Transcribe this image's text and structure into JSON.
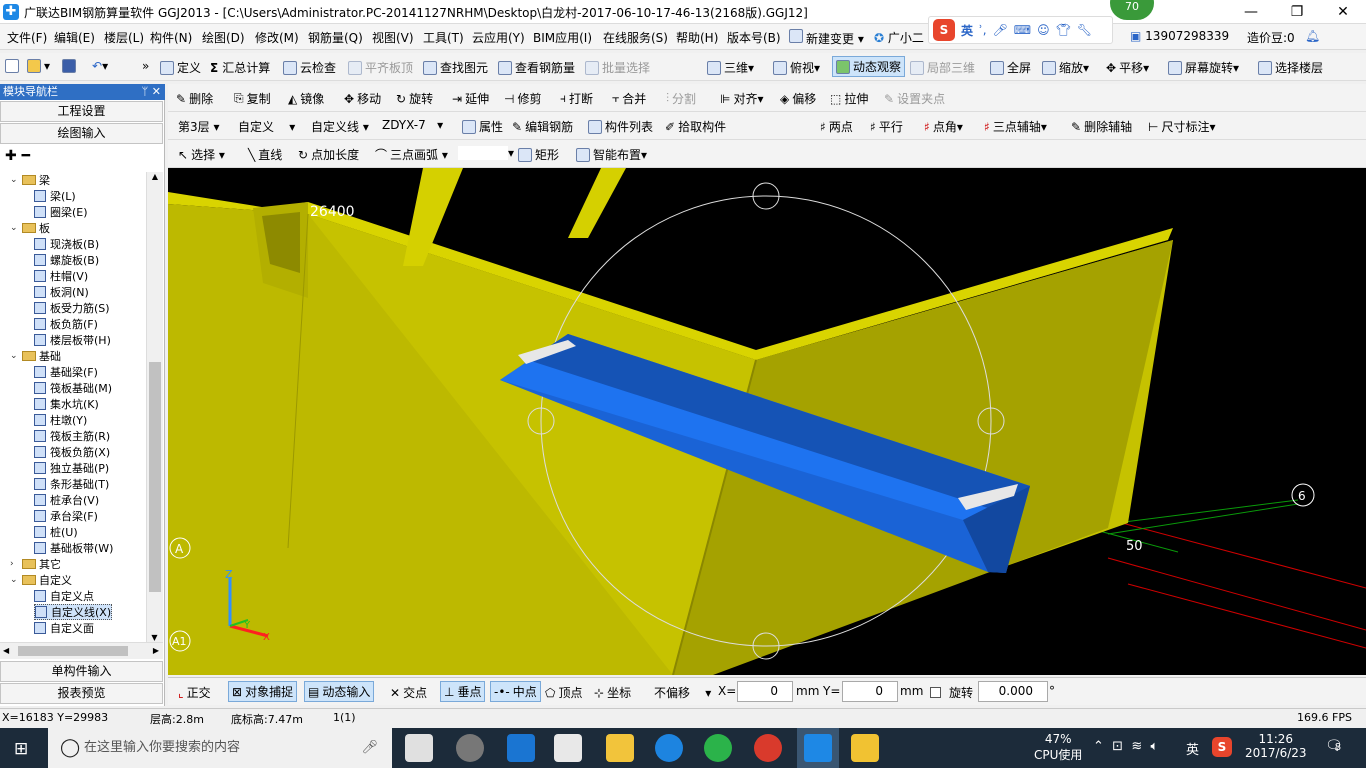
{
  "window": {
    "title": "广联达BIM钢筋算量软件 GGJ2013 - [C:\\Users\\Administrator.PC-20141127NRHM\\Desktop\\白龙村-2017-06-10-17-46-13(2168版).GGJ12]",
    "badge": "70",
    "controls": [
      "—",
      "❐",
      "✕"
    ]
  },
  "menu": [
    "文件(F)",
    "编辑(E)",
    "楼层(L)",
    "构件(N)",
    "绘图(D)",
    "修改(M)",
    "钢筋量(Q)",
    "视图(V)",
    "工具(T)",
    "云应用(Y)",
    "BIM应用(I)",
    "在线服务(S)",
    "帮助(H)",
    "版本号(B)",
    "新建变更",
    "广小二"
  ],
  "ime": {
    "mode": "英"
  },
  "account": {
    "user": "13907298339",
    "points_label": "造价豆:0"
  },
  "toolbar1": [
    "定义",
    "汇总计算",
    "云检查",
    "平齐板顶",
    "查找图元",
    "查看钢筋量",
    "批量选择",
    "三维",
    "俯视",
    "动态观察",
    "局部三维",
    "全屏",
    "缩放",
    "平移",
    "屏幕旋转",
    "选择楼层"
  ],
  "toolbar2": [
    "删除",
    "复制",
    "镜像",
    "移动",
    "旋转",
    "延伸",
    "修剪",
    "打断",
    "合并",
    "分割",
    "对齐",
    "偏移",
    "拉伸",
    "设置夹点"
  ],
  "toolbar3": {
    "floor": "第3层",
    "category": "自定义",
    "type": "自定义线",
    "element": "ZDYX-7",
    "actions": [
      "属性",
      "编辑钢筋",
      "构件列表",
      "拾取构件"
    ],
    "right": [
      "两点",
      "平行",
      "点角",
      "三点辅轴",
      "删除辅轴",
      "尺寸标注"
    ]
  },
  "toolbar4": [
    "选择",
    "直线",
    "点加长度",
    "三点画弧",
    "矩形",
    "智能布置"
  ],
  "nav": {
    "title": "模块导航栏",
    "pin": "ᛘ ✕",
    "top_buttons": [
      "工程设置",
      "绘图输入"
    ],
    "bottom_buttons": [
      "单构件输入",
      "报表预览"
    ],
    "tree": [
      {
        "label": "梁",
        "level": 0,
        "type": "folder",
        "open": true
      },
      {
        "label": "梁(L)",
        "level": 1,
        "type": "leaf"
      },
      {
        "label": "圈梁(E)",
        "level": 1,
        "type": "leaf"
      },
      {
        "label": "板",
        "level": 0,
        "type": "folder",
        "open": true
      },
      {
        "label": "现浇板(B)",
        "level": 1,
        "type": "leaf"
      },
      {
        "label": "螺旋板(B)",
        "level": 1,
        "type": "leaf"
      },
      {
        "label": "柱帽(V)",
        "level": 1,
        "type": "leaf"
      },
      {
        "label": "板洞(N)",
        "level": 1,
        "type": "leaf"
      },
      {
        "label": "板受力筋(S)",
        "level": 1,
        "type": "leaf"
      },
      {
        "label": "板负筋(F)",
        "level": 1,
        "type": "leaf"
      },
      {
        "label": "楼层板带(H)",
        "level": 1,
        "type": "leaf"
      },
      {
        "label": "基础",
        "level": 0,
        "type": "folder",
        "open": true
      },
      {
        "label": "基础梁(F)",
        "level": 1,
        "type": "leaf"
      },
      {
        "label": "筏板基础(M)",
        "level": 1,
        "type": "leaf"
      },
      {
        "label": "集水坑(K)",
        "level": 1,
        "type": "leaf"
      },
      {
        "label": "柱墩(Y)",
        "level": 1,
        "type": "leaf"
      },
      {
        "label": "筏板主筋(R)",
        "level": 1,
        "type": "leaf"
      },
      {
        "label": "筏板负筋(X)",
        "level": 1,
        "type": "leaf"
      },
      {
        "label": "独立基础(P)",
        "level": 1,
        "type": "leaf"
      },
      {
        "label": "条形基础(T)",
        "level": 1,
        "type": "leaf"
      },
      {
        "label": "桩承台(V)",
        "level": 1,
        "type": "leaf"
      },
      {
        "label": "承台梁(F)",
        "level": 1,
        "type": "leaf"
      },
      {
        "label": "桩(U)",
        "level": 1,
        "type": "leaf"
      },
      {
        "label": "基础板带(W)",
        "level": 1,
        "type": "leaf"
      },
      {
        "label": "其它",
        "level": 0,
        "type": "folder",
        "open": false
      },
      {
        "label": "自定义",
        "level": 0,
        "type": "folder",
        "open": true
      },
      {
        "label": "自定义点",
        "level": 1,
        "type": "leaf"
      },
      {
        "label": "自定义线(X)",
        "level": 1,
        "type": "leaf",
        "selected": true
      },
      {
        "label": "自定义面",
        "level": 1,
        "type": "leaf"
      }
    ]
  },
  "viewport": {
    "dim_label": "26400",
    "axis_labels": [
      "A",
      "A1",
      "6",
      "50"
    ],
    "axis_gizmo": {
      "z": "Z",
      "y": "Y",
      "x": "X"
    },
    "colors": {
      "wall": "#c8c400",
      "beam": "#1a63d6",
      "grid_red": "#e00000",
      "grid_green": "#00b000"
    }
  },
  "status": {
    "snaps": [
      "正交",
      "对象捕捉",
      "动态输入",
      "交点",
      "垂点",
      "中点",
      "顶点",
      "坐标"
    ],
    "offset_mode": "不偏移",
    "x_label": "X=",
    "x_value": "0",
    "x_unit": "mm",
    "y_label": "Y=",
    "y_value": "0",
    "y_unit": "mm",
    "rotate_label": "旋转",
    "rotate_value": "0.000",
    "deg": "°"
  },
  "coords": {
    "xy": "X=16183 Y=29983",
    "floor_height": "层高:2.8m",
    "base_height": "底标高:7.47m",
    "count": "1(1)",
    "fps": "169.6 FPS"
  },
  "taskbar": {
    "search_placeholder": "在这里输入你要搜索的内容",
    "cpu_percent": "47%",
    "cpu_label": "CPU使用",
    "ime": "英",
    "time": "11:26",
    "date": "2017/6/23",
    "notifications": "8"
  }
}
